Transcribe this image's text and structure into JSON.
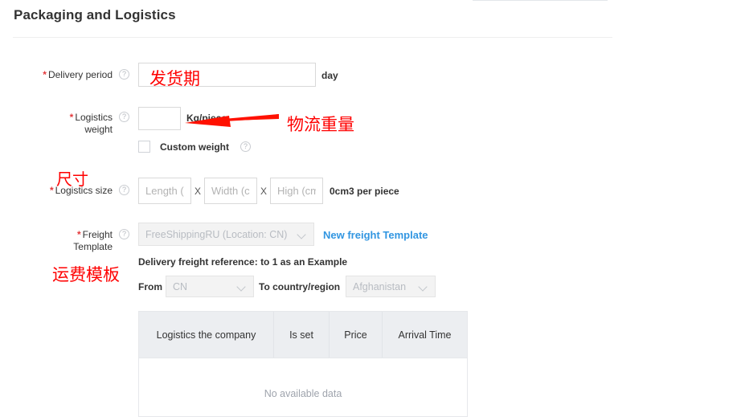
{
  "page": {
    "section_title": "Packaging and Logistics"
  },
  "form": {
    "delivery_period": {
      "label": "Delivery period",
      "required_marker": "*",
      "help_icon": "question-circle-icon",
      "value": "",
      "placeholder": "",
      "unit": "day"
    },
    "logistics_weight": {
      "label_line1": "Logistics",
      "label_line2": "weight",
      "required_marker": "*",
      "help_icon": "question-circle-icon",
      "value": "",
      "placeholder": "",
      "unit": "Kg/piece",
      "custom_weight": {
        "label": "Custom weight",
        "checked": false,
        "help_icon": "question-circle-icon"
      }
    },
    "logistics_size": {
      "label": "Logistics size",
      "required_marker": "*",
      "help_icon": "question-circle-icon",
      "length_placeholder": "Length (cm)",
      "width_placeholder": "Width (cm)",
      "high_placeholder": "High (cm)",
      "length_value": "",
      "width_value": "",
      "high_value": "",
      "separator": "X",
      "volume_text": "0cm3 per piece"
    },
    "freight_template": {
      "label_line1": "Freight",
      "label_line2": "Template",
      "required_marker": "*",
      "help_icon": "question-circle-icon",
      "selected": "FreeShippingRU (Location: CN)",
      "chevron_icon": "chevron-down-icon",
      "new_template_link": "New freight Template",
      "reference_text": "Delivery freight reference: to 1 as an Example",
      "from_label": "From",
      "from_value": "CN",
      "to_label": "To country/region",
      "to_value": "Afghanistan"
    }
  },
  "freight_table": {
    "columns": [
      "Logistics the company",
      "Is set",
      "Price",
      "Arrival Time"
    ],
    "empty_text": "No available data",
    "rows": []
  },
  "annotations": {
    "color": "#ff0000",
    "items": [
      {
        "text": "发货期",
        "meaning": "delivery-period"
      },
      {
        "text": "物流重量",
        "meaning": "logistics-weight"
      },
      {
        "text": "尺寸",
        "meaning": "size"
      },
      {
        "text": "运费模板",
        "meaning": "freight-template"
      }
    ],
    "arrow": {
      "name": "red-arrow-pointing-to-weight-input"
    }
  }
}
